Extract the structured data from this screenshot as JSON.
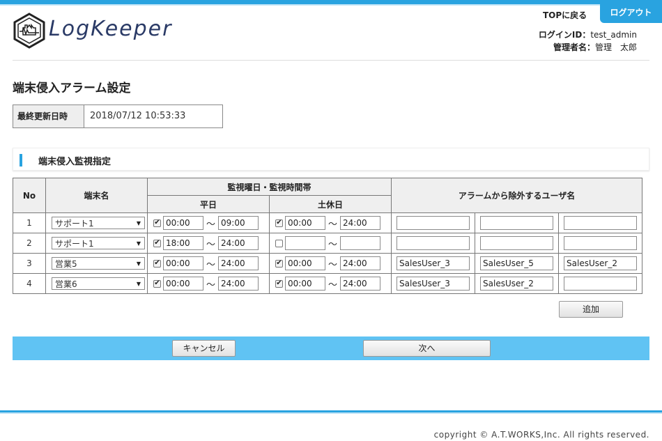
{
  "header": {
    "logo_text": "LogKeeper",
    "top_link": "TOPに戻る",
    "logout": "ログアウト",
    "login_id_label": "ログインID：",
    "login_id_value": "test_admin",
    "admin_name_label": "管理者名：",
    "admin_name_value": "管理　太郎"
  },
  "page": {
    "title": "端末侵入アラーム設定",
    "last_updated_label": "最終更新日時",
    "last_updated_value": "2018/07/12 10:53:33",
    "section_title": "端末侵入監視指定"
  },
  "table": {
    "headers": {
      "no": "No",
      "terminal": "端末名",
      "monitor": "監視曜日・監視時間帯",
      "weekday": "平日",
      "holiday": "土休日",
      "exclude": "アラームから除外するユーザ名"
    },
    "tilde": "～",
    "rows": [
      {
        "no": "1",
        "terminal": "サポート1",
        "weekday": {
          "checked": true,
          "from": "00:00",
          "to": "09:00"
        },
        "holiday": {
          "checked": true,
          "from": "00:00",
          "to": "24:00"
        },
        "users": [
          "",
          "",
          ""
        ]
      },
      {
        "no": "2",
        "terminal": "サポート1",
        "weekday": {
          "checked": true,
          "from": "18:00",
          "to": "24:00"
        },
        "holiday": {
          "checked": false,
          "from": "",
          "to": ""
        },
        "users": [
          "",
          "",
          ""
        ]
      },
      {
        "no": "3",
        "terminal": "営業5",
        "weekday": {
          "checked": true,
          "from": "00:00",
          "to": "24:00"
        },
        "holiday": {
          "checked": true,
          "from": "00:00",
          "to": "24:00"
        },
        "users": [
          "SalesUser_3",
          "SalesUser_5",
          "SalesUser_2"
        ]
      },
      {
        "no": "4",
        "terminal": "営業6",
        "weekday": {
          "checked": true,
          "from": "00:00",
          "to": "24:00"
        },
        "holiday": {
          "checked": true,
          "from": "00:00",
          "to": "24:00"
        },
        "users": [
          "SalesUser_3",
          "SalesUser_2",
          ""
        ]
      }
    ]
  },
  "buttons": {
    "add": "追加",
    "cancel": "キャンセル",
    "next": "次へ"
  },
  "footer": {
    "copyright": "copyright © A.T.WORKS,Inc. All rights reserved."
  },
  "colors": {
    "accent": "#29a3e0",
    "action_bar": "#60c3f3"
  }
}
